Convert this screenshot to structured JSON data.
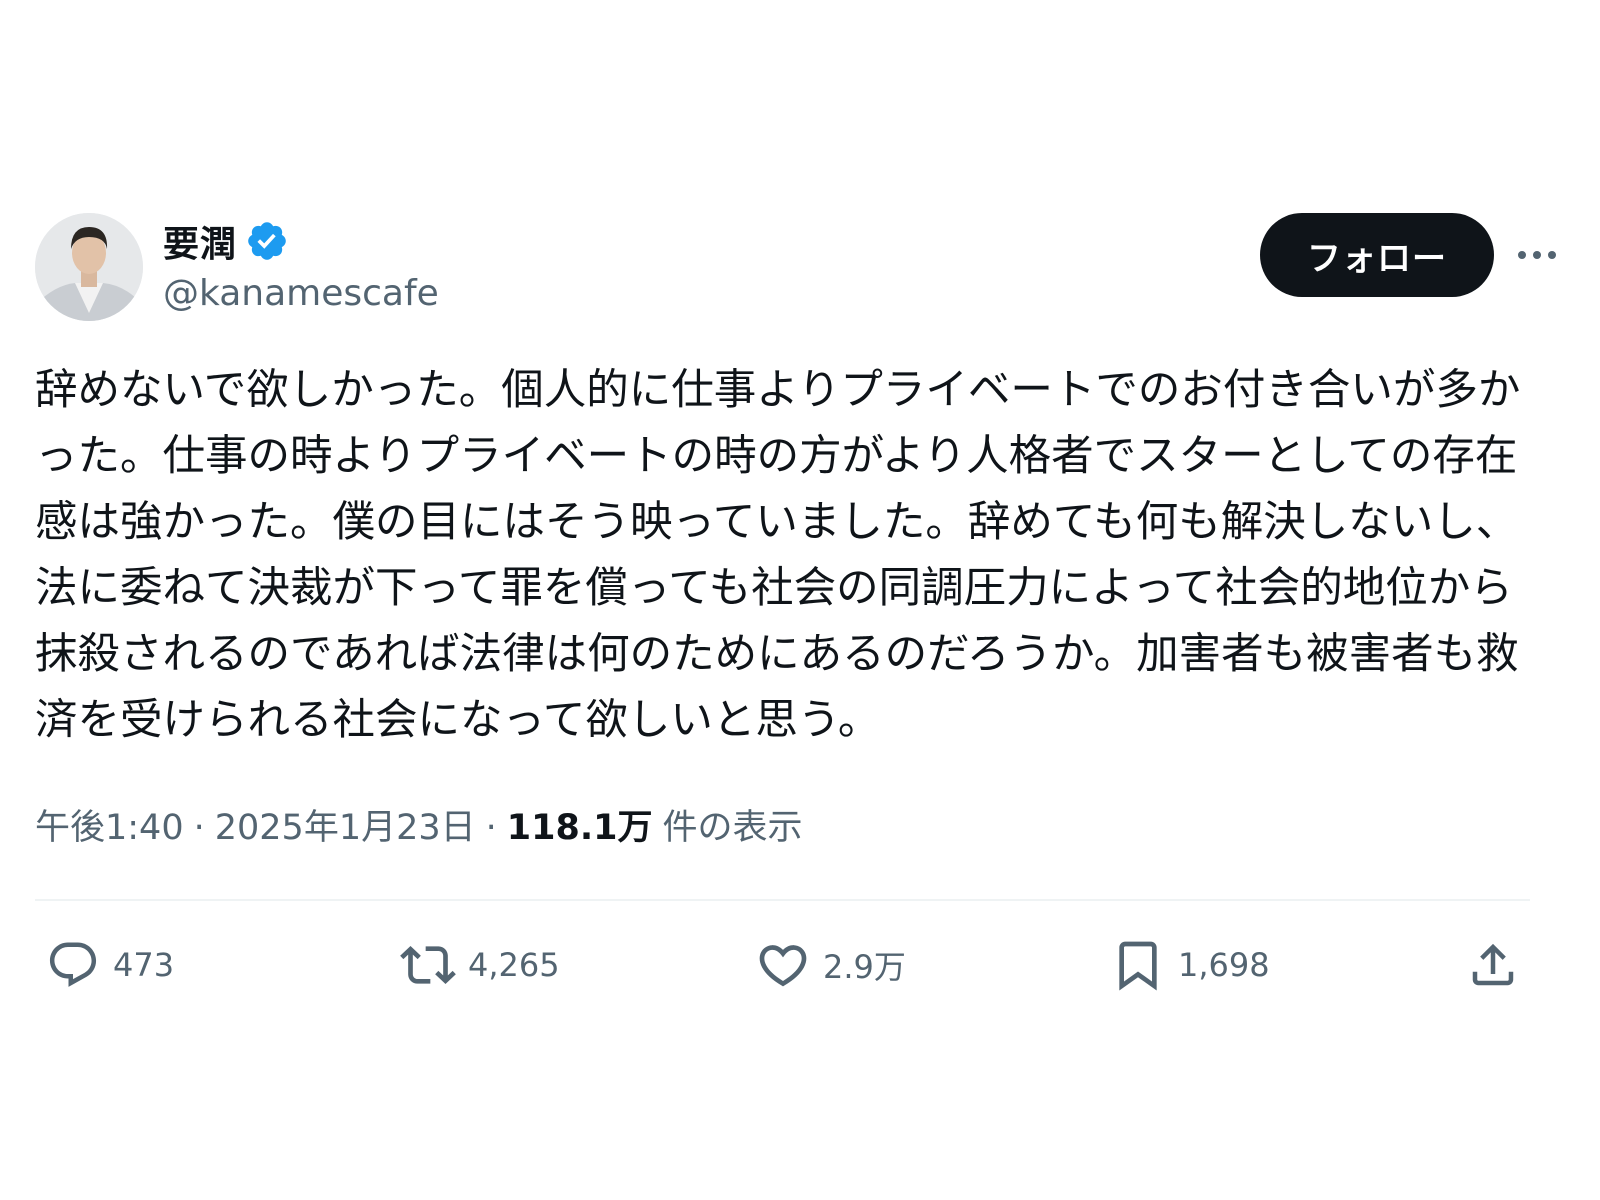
{
  "user": {
    "display_name": "要潤",
    "handle": "@kanamescafe",
    "verified_icon": "verified-badge-icon",
    "avatar": "profile-photo"
  },
  "header": {
    "follow_label": "フォロー",
    "more_icon": "ellipsis-icon"
  },
  "tweet": {
    "text": "辞めないで欲しかった。個人的に仕事よりプライベートでのお付き合いが多かった。仕事の時よりプライベートの時の方がより人格者でスターとしての存在感は強かった。僕の目にはそう映っていました。辞めても何も解決しないし、法に委ねて決裁が下って罪を償っても社会の同調圧力によって社会的地位から抹殺されるのであれば法律は何のためにあるのだろうか。加害者も被害者も救済を受けられる社会になって欲しいと思う。"
  },
  "meta": {
    "time": "午後1:40",
    "separator": "·",
    "date": "2025年1月23日",
    "views_count": "118.1万",
    "views_label": "件の表示"
  },
  "actions": {
    "reply": {
      "icon": "reply-icon",
      "count": "473"
    },
    "retweet": {
      "icon": "retweet-icon",
      "count": "4,265"
    },
    "like": {
      "icon": "heart-icon",
      "count": "2.9万"
    },
    "bookmark": {
      "icon": "bookmark-icon",
      "count": "1,698"
    },
    "share": {
      "icon": "share-icon"
    }
  },
  "colors": {
    "text": "#0f1419",
    "secondary": "#536471",
    "verified": "#1d9bf0",
    "button_bg": "#0f1419",
    "divider": "#eff3f4"
  }
}
